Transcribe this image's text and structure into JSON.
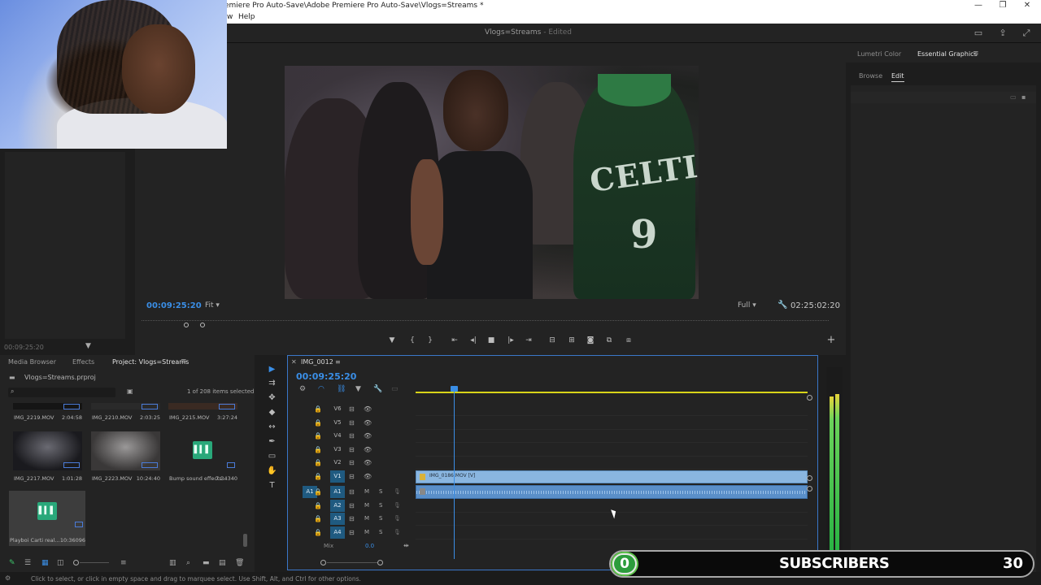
{
  "window": {
    "title": "emiere Pro Auto-Save\\Adobe Premiere Pro Auto-Save\\Vlogs=Streams *",
    "minimize": "—",
    "maximize": "❐",
    "close": "✕"
  },
  "menu": {
    "items": [
      "w",
      "Help"
    ]
  },
  "header": {
    "workspace": "Vlogs=Streams",
    "edited": " - Edited"
  },
  "left_panel": {
    "timecode": "00:09:25:20"
  },
  "program": {
    "timecode": "00:09:25:20",
    "fit": "Fit",
    "quality": "Full",
    "duration": "02:25:02:20",
    "jersey_text": "CELTI",
    "jersey_number": "9"
  },
  "right_panel": {
    "tabs": [
      "Lumetri Color",
      "Essential Graphics"
    ],
    "subtabs": [
      "Browse",
      "Edit"
    ]
  },
  "project": {
    "tabs": [
      "Media Browser",
      "Effects",
      "Project: Vlogs=Streams"
    ],
    "file": "Vlogs=Streams.prproj",
    "count": "1 of 208 items selected",
    "clips": [
      {
        "name": "IMG_2219.MOV",
        "duration": "2:04:58"
      },
      {
        "name": "IMG_2210.MOV",
        "duration": "2:03:25"
      },
      {
        "name": "IMG_2215.MOV",
        "duration": "3:27:24"
      },
      {
        "name": "IMG_2217.MOV",
        "duration": "1:01:28"
      },
      {
        "name": "IMG_2223.MOV",
        "duration": "10:24:40"
      },
      {
        "name": "Bump sound effects...",
        "duration": "7:34340"
      },
      {
        "name": "Playboi Carti real...",
        "duration": "10:36096"
      }
    ]
  },
  "timeline": {
    "sequence": "IMG_0012",
    "timecode": "00:09:25:20",
    "video_tracks": [
      "V6",
      "V5",
      "V4",
      "V3",
      "V2",
      "V1"
    ],
    "audio_tracks": [
      "A1",
      "A2",
      "A3",
      "A4"
    ],
    "source_audio": "A1",
    "mute": "M",
    "solo": "S",
    "mix_label": "Mix",
    "mix_value": "0.0",
    "video_clip": "IMG_0186.MOV [V]"
  },
  "subscriber_widget": {
    "current": "0",
    "label": "SUBSCRIBERS",
    "goal": "30",
    "progress": 0.0
  },
  "status": {
    "text": "Click to select, or click in empty space and drag to marquee select. Use Shift, Alt, and Ctrl for other options."
  },
  "colors": {
    "accent": "#3a8ee6",
    "sub_fill": "#5ec24b",
    "ruler": "#d8d419"
  }
}
